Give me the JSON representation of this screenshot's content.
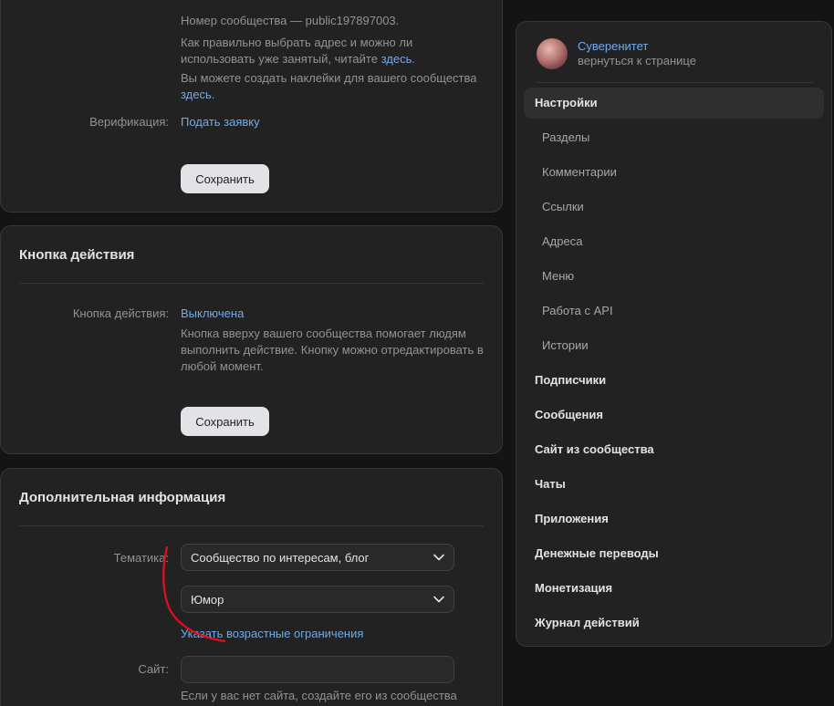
{
  "main_settings": {
    "community_number": "Номер сообщества — public197897003.",
    "address_hint_text": "Как правильно выбрать адрес и можно ли использовать уже занятый, читайте",
    "address_hint_link": "здесь",
    "stickers_hint_text": "Вы можете создать наклейки для вашего сообщества",
    "stickers_hint_link": "здесь",
    "verification_label": "Верификация:",
    "verification_link": "Подать заявку",
    "save_label": "Сохранить"
  },
  "action_button": {
    "title": "Кнопка действия",
    "label": "Кнопка действия:",
    "value": "Выключена",
    "hint": "Кнопка вверху вашего сообщества помогает людям выполнить действие. Кнопку можно отредактировать в любой момент.",
    "save_label": "Сохранить"
  },
  "additional_info": {
    "title": "Дополнительная информация",
    "topic_label": "Тематика:",
    "topic_value": "Сообщество по интересам, блог",
    "subtopic_value": "Юмор",
    "age_link": "Указать возрастные ограничения",
    "site_label": "Сайт:",
    "site_value": "",
    "site_hint": "Если у вас нет сайта, создайте его из сообщества"
  },
  "menu": {
    "community_name": "Суверенитет",
    "back_label": "вернуться к странице",
    "active_item": "Настройки",
    "sub_items": [
      "Разделы",
      "Комментарии",
      "Ссылки",
      "Адреса",
      "Меню",
      "Работа с API",
      "Истории"
    ],
    "main_items": [
      "Подписчики",
      "Сообщения",
      "Сайт из сообщества",
      "Чаты",
      "Приложения",
      "Денежные переводы",
      "Монетизация",
      "Журнал действий"
    ]
  },
  "colors": {
    "background": "#141414",
    "card": "#222222",
    "link": "#71aaeb",
    "annotation": "#e0101e"
  },
  "icons": {
    "select_arrow": "chevron-down-icon"
  }
}
